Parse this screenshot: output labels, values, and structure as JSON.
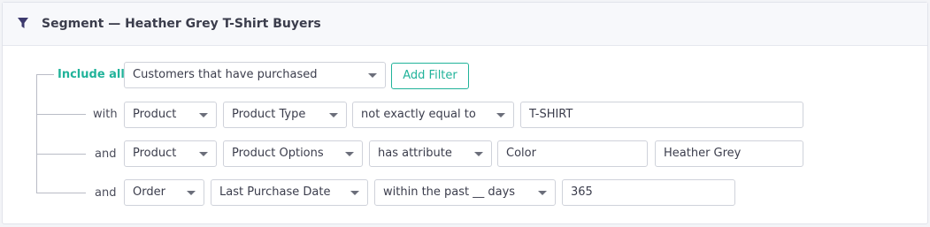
{
  "header": {
    "title": "Segment — Heather Grey T-Shirt Buyers",
    "icon": "filter-icon",
    "icon_color": "#3d3a6e"
  },
  "root": {
    "label": "Include all",
    "selector": "Customers that have purchased",
    "add_filter_label": "Add Filter"
  },
  "conditions": [
    {
      "connector": "with",
      "entity": "Product",
      "field": "Product Type",
      "operator": "not exactly equal to",
      "value": "T-SHIRT"
    },
    {
      "connector": "and",
      "entity": "Product",
      "field": "Product Options",
      "operator": "has attribute",
      "attribute": "Color",
      "value": "Heather Grey"
    },
    {
      "connector": "and",
      "entity": "Order",
      "field": "Last Purchase Date",
      "operator": "within the past __ days",
      "value": "365"
    }
  ],
  "colors": {
    "accent": "#21b39a",
    "border": "#cfd2da",
    "tree_line": "#b9bcc6"
  }
}
